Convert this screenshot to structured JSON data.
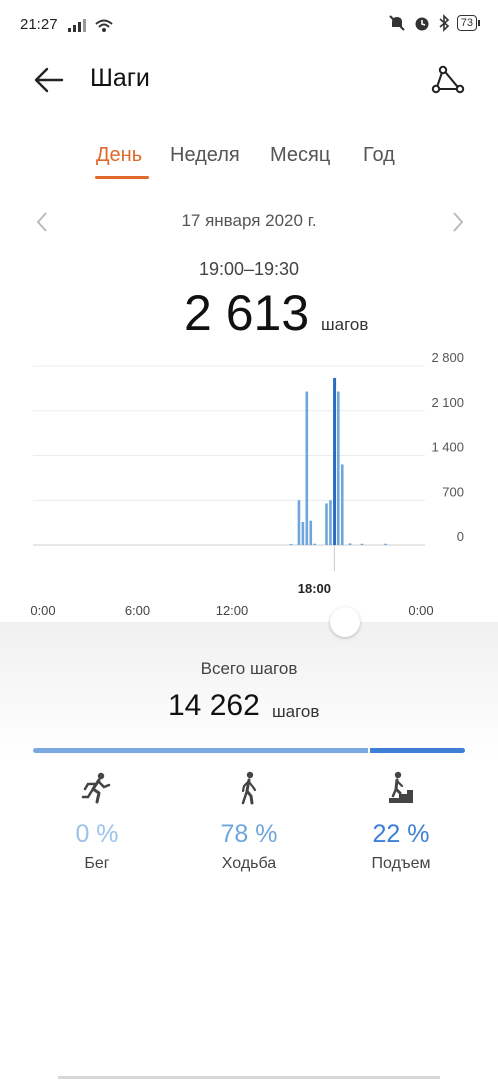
{
  "status_bar": {
    "time": "21:27",
    "battery": "73"
  },
  "header": {
    "title": "Шаги"
  },
  "tabs": [
    {
      "label": "День",
      "active": true
    },
    {
      "label": "Неделя",
      "active": false
    },
    {
      "label": "Месяц",
      "active": false
    },
    {
      "label": "Год",
      "active": false
    }
  ],
  "date_nav": {
    "date": "17 января 2020 г."
  },
  "selection": {
    "interval": "19:00–19:30",
    "steps": "2 613",
    "unit": "шагов",
    "cursor_label": "18:00"
  },
  "chart_data": {
    "type": "bar",
    "y_ticks": [
      "2 800",
      "2 100",
      "1 400",
      "700",
      "0"
    ],
    "ylim": [
      0,
      2800
    ],
    "x_ticks": [
      "0:00",
      "6:00",
      "12:00",
      "0:00"
    ],
    "xlim": [
      0,
      24
    ],
    "grid": true,
    "x": [
      15.75,
      16.25,
      16.5,
      16.75,
      17.0,
      17.25,
      18.0,
      18.25,
      18.5,
      18.75,
      19.0,
      19.5,
      20.25,
      21.75
    ],
    "values": [
      15,
      700,
      360,
      2400,
      380,
      20,
      650,
      700,
      2613,
      2400,
      1260,
      25,
      20,
      20
    ],
    "highlight_x": 18.5,
    "colors": {
      "bar": "#6ea6dc",
      "highlight": "#2b6cc2"
    }
  },
  "summary": {
    "total_label": "Всего шагов",
    "total_steps": "14 262",
    "unit": "шагов",
    "split": {
      "walk_fraction": 0.78,
      "climb_fraction": 0.22
    }
  },
  "activities": [
    {
      "icon": "running-icon",
      "percent": "0 %",
      "label": "Бег",
      "color": "#9cc3ea"
    },
    {
      "icon": "walking-icon",
      "percent": "78 %",
      "label": "Ходьба",
      "color": "#6ea6dc"
    },
    {
      "icon": "stairs-icon",
      "percent": "22 %",
      "label": "Подъем",
      "color": "#3d7fd6"
    }
  ]
}
